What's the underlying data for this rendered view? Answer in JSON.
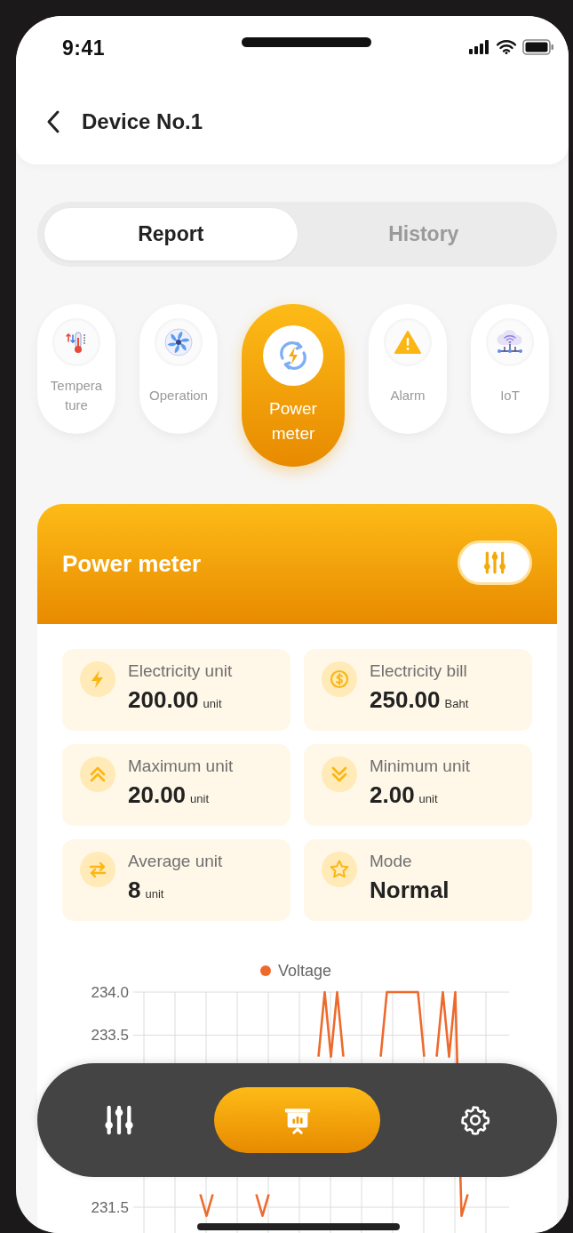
{
  "status_bar": {
    "time": "9:41"
  },
  "header": {
    "title": "Device No.1"
  },
  "tabs": [
    {
      "label": "Report",
      "selected": true
    },
    {
      "label": "History",
      "selected": false
    }
  ],
  "categories": [
    {
      "label": "Tempera ture",
      "selected": false
    },
    {
      "label": "Operation",
      "selected": false
    },
    {
      "label": "Power meter",
      "selected": true
    },
    {
      "label": "Alarm",
      "selected": false
    },
    {
      "label": "IoT",
      "selected": false
    }
  ],
  "card": {
    "title": "Power meter",
    "stats": [
      {
        "label": "Electricity unit",
        "value": "200.00",
        "unit": "unit"
      },
      {
        "label": "Electricity bill",
        "value": "250.00",
        "unit": "Baht"
      },
      {
        "label": "Maximum unit",
        "value": "20.00",
        "unit": "unit"
      },
      {
        "label": "Minimum unit",
        "value": "2.00",
        "unit": "unit"
      },
      {
        "label": "Average unit",
        "value": "8",
        "unit": "unit"
      },
      {
        "label": "Mode",
        "value": "Normal"
      }
    ],
    "chart_data": {
      "type": "line",
      "grid": true,
      "ylim": [
        231.2,
        234.0
      ],
      "yticks": [
        {
          "value": 234.0,
          "label": "234.0"
        },
        {
          "value": 233.5,
          "label": "233.5"
        },
        {
          "value": 231.5,
          "label": "231.5"
        }
      ],
      "series": [
        {
          "name": "Voltage",
          "color": "#ee6a2c",
          "values": [
            null,
            null,
            null,
            null,
            null,
            null,
            null,
            null,
            null,
            null,
            231.65,
            231.4,
            231.65,
            null,
            null,
            null,
            null,
            null,
            null,
            231.65,
            231.4,
            231.65,
            null,
            null,
            null,
            null,
            null,
            null,
            null,
            233.25,
            234.0,
            233.25,
            234.0,
            233.25,
            null,
            null,
            null,
            null,
            null,
            233.25,
            234.0,
            234.0,
            234.0,
            234.0,
            234.0,
            234.0,
            233.25,
            null,
            233.25,
            234.0,
            233.25,
            234.0,
            231.4,
            231.65,
            null,
            null,
            null,
            null,
            null,
            null
          ]
        }
      ]
    }
  },
  "nav": {
    "items": [
      {
        "selected": false
      },
      {
        "selected": true
      },
      {
        "selected": false
      }
    ]
  }
}
